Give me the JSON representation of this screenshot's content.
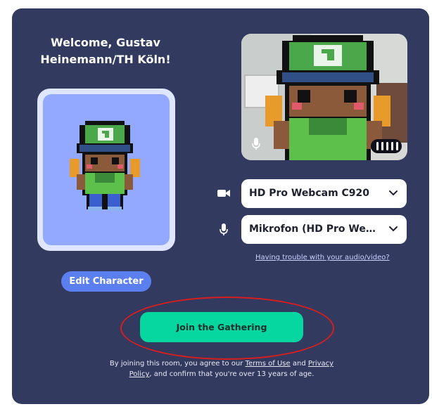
{
  "welcome": {
    "line1": "Welcome, Gustav",
    "line2": "Heinemann/TH Köln!"
  },
  "edit_character_label": "Edit Character",
  "camera_select": {
    "value": "HD Pro Webcam C920",
    "icon": "video-camera-icon"
  },
  "mic_select": {
    "value": "Mikrofon (HD Pro Webcam ...",
    "icon": "microphone-icon"
  },
  "trouble_link": "Having trouble with your audio/video?",
  "join_label": "Join the Gathering",
  "terms": {
    "prefix": "By joining this room, you agree to our",
    "terms_link": "Terms of Use",
    "and": "and",
    "privacy_link_1": "Privacy",
    "privacy_link_2": "Policy",
    "suffix": ", and confirm that you're over 13 years of age."
  },
  "colors": {
    "panel": "#333a5f",
    "join_button": "#06d6a0",
    "edit_button": "#5c7ff0",
    "avatar_bg": "#93a8ff",
    "highlight_ring": "#d81e1e"
  }
}
